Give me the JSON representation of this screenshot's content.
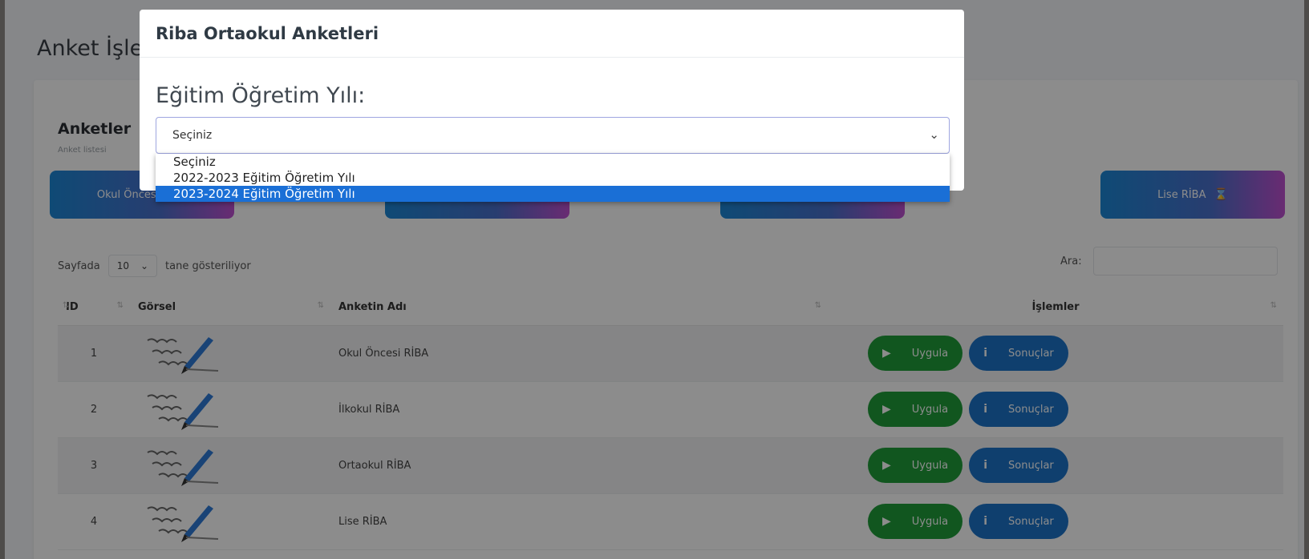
{
  "page": {
    "title": "Anket İşlemleri"
  },
  "card": {
    "title": "Anketler",
    "subtitle": "Anket listesi"
  },
  "categories": [
    {
      "label": "Okul Öncesi RİBA"
    },
    {
      "label": ""
    },
    {
      "label": ""
    },
    {
      "label": "Lise RİBA"
    }
  ],
  "table_controls": {
    "prefix": "Sayfada",
    "page_size": "10",
    "suffix": "tane gösteriliyor",
    "search_label": "Ara:"
  },
  "table": {
    "columns": [
      "ID",
      "Görsel",
      "Anketin Adı",
      "İşlemler"
    ],
    "rows": [
      {
        "id": "1",
        "name": "Okul Öncesi RİBA"
      },
      {
        "id": "2",
        "name": "İlkokul RİBA"
      },
      {
        "id": "3",
        "name": "Ortaokul RİBA"
      },
      {
        "id": "4",
        "name": "Lise RİBA"
      }
    ],
    "apply_label": "Uygula",
    "results_label": "Sonuçlar"
  },
  "modal": {
    "title": "Riba Ortaokul Anketleri",
    "field_label": "Eğitim Öğretim Yılı:",
    "selected_value": "Seçiniz",
    "options": [
      "Seçiniz",
      "2022-2023 Eğitim Öğretim Yılı",
      "2023-2024 Eğitim Öğretim Yılı"
    ],
    "highlighted_option": "2023-2024 Eğitim Öğretim Yılı"
  },
  "colors": {
    "primary": "#1d74c9",
    "success": "#1f9d3a",
    "gradient_end": "#c04fd0",
    "highlight": "#1a6fd6"
  },
  "icons": {
    "play": "play-icon",
    "info": "info-icon",
    "sort": "sort-icon",
    "chevron": "chevron-down-icon",
    "hourglass": "hourglass-icon"
  }
}
